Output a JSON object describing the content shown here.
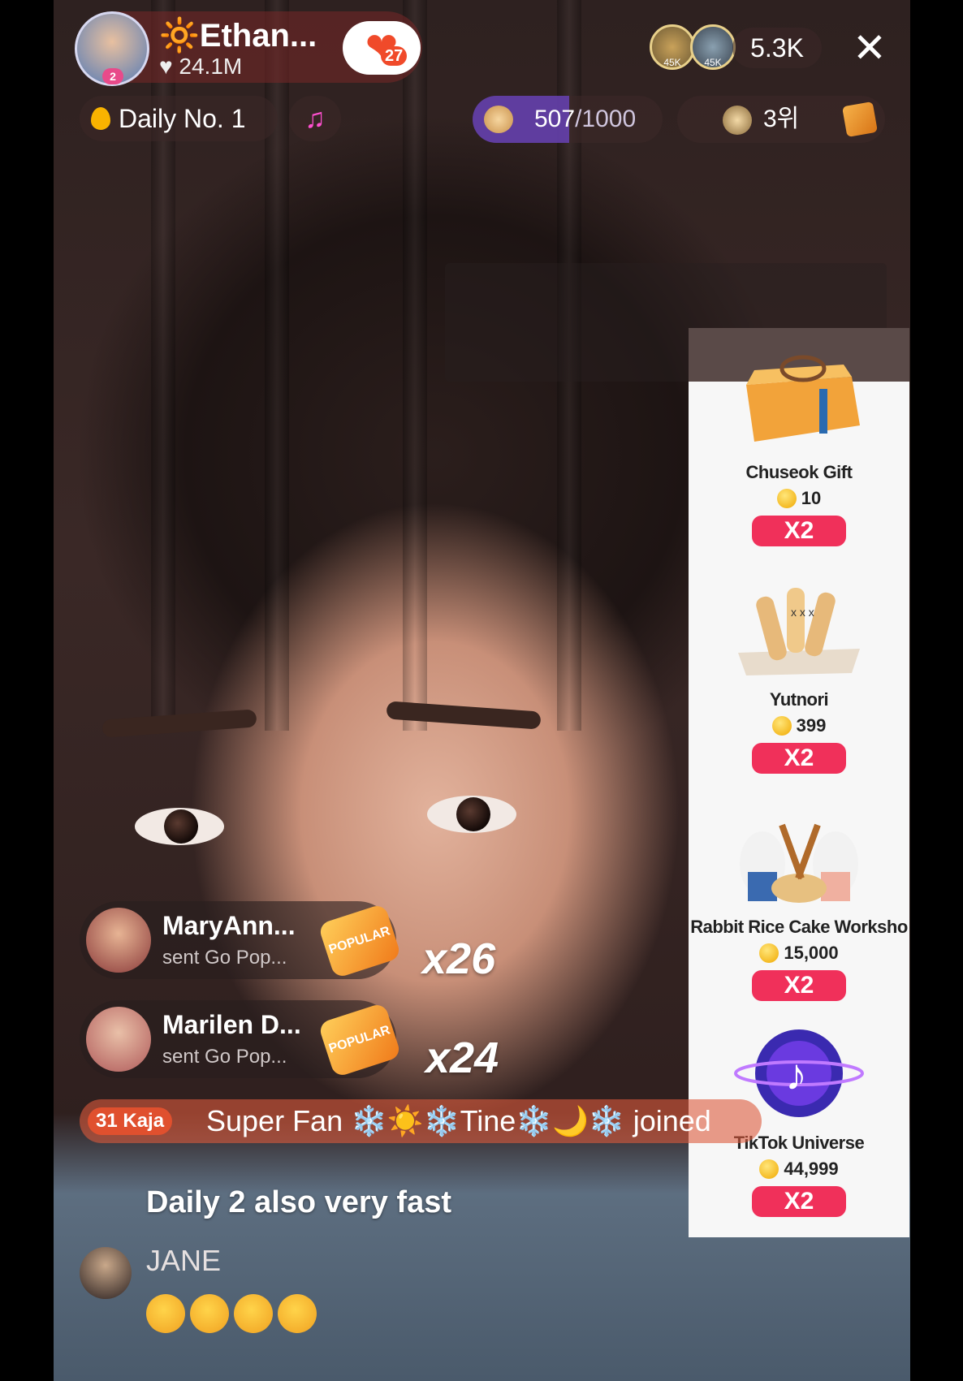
{
  "host": {
    "name": "🔆Ethan...",
    "likes": "24.1M",
    "follow_badge_count": "27",
    "avatar_badge": "2"
  },
  "viewers": {
    "coin_labels": [
      "45K",
      "45K"
    ],
    "count": "5.3K"
  },
  "daily": {
    "label": "Daily No. 1"
  },
  "goal": {
    "current": "507",
    "total": "/1000",
    "progress": 0.507
  },
  "rank": {
    "label": "3위"
  },
  "gifts": [
    {
      "name": "Chuseok Gift",
      "price": "10",
      "multiplier": "X2"
    },
    {
      "name": "Yutnori",
      "price": "399",
      "multiplier": "X2"
    },
    {
      "name": "Rabbit Rice Cake Worksho",
      "price": "15,000",
      "multiplier": "X2"
    },
    {
      "name": "TikTok Universe",
      "price": "44,999",
      "multiplier": "X2"
    }
  ],
  "gift_notifications": [
    {
      "user": "MaryAnn...",
      "action": "sent Go Pop...",
      "badge": "POPULAR",
      "combo": "x26"
    },
    {
      "user": "Marilen D...",
      "action": "sent Go Pop...",
      "badge": "POPULAR",
      "combo": "x24"
    }
  ],
  "join_banner": {
    "badge_level": "31",
    "badge_name": "Kaja",
    "text": "Super Fan ❄️☀️❄️Tine❄️🌙❄️ joined"
  },
  "comments": [
    {
      "user": "",
      "text": "Daily 2 also very fast"
    },
    {
      "user": "JANE",
      "text": ""
    }
  ],
  "colors": {
    "accent_red": "#f0305a",
    "progress_purple": "#6e46c8",
    "follow_heart": "#f04a2a"
  }
}
